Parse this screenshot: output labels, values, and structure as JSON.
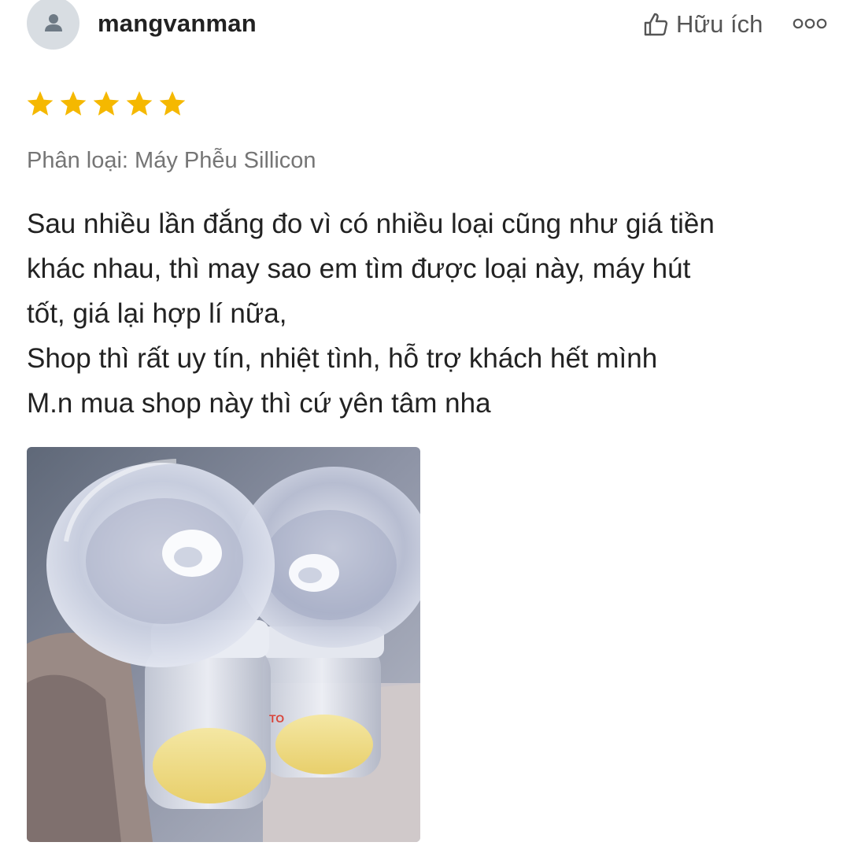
{
  "review": {
    "username": "mangvanman",
    "helpful_label": "Hữu ích",
    "rating": 5,
    "variation": "Phân loại: Máy Phễu Sillicon",
    "text_lines": [
      "Sau nhiều lần đắng đo vì có nhiều loại cũng như giá tiền",
      "khác nhau, thì may sao em tìm được loại này, máy hút",
      "tốt, giá lại hợp lí nữa,",
      "Shop thì rất uy tín, nhiệt tình, hỗ trợ khách hết mình",
      "M.n mua shop này thì cứ yên tâm nha"
    ],
    "photo_label": "TO"
  },
  "icons": {
    "avatar": "user-icon",
    "helpful": "thumbs-up-icon",
    "more": "more-options-icon",
    "star": "star-icon"
  },
  "colors": {
    "star": "#f5b800",
    "username": "#222222",
    "variation": "#757575",
    "helpful": "#555555",
    "avatar_bg": "#d8dde2",
    "avatar_fg": "#6e7a85"
  }
}
